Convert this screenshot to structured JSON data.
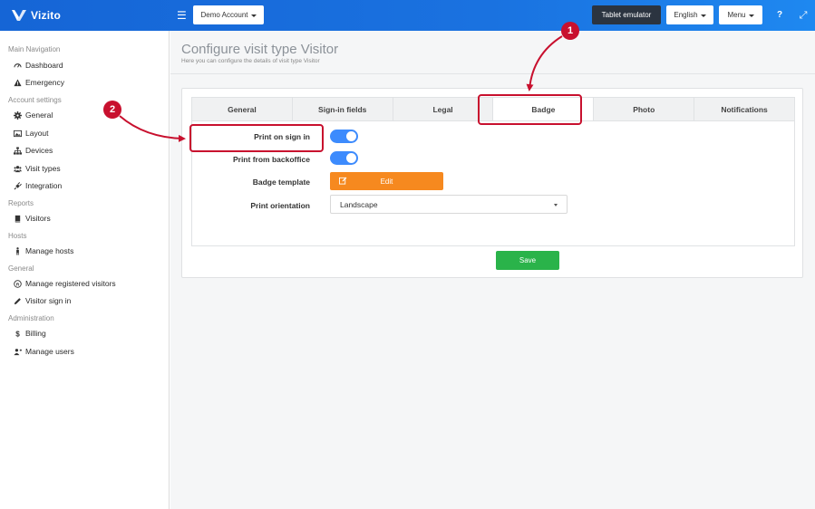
{
  "app": {
    "logo_text": "Vizito"
  },
  "topbar": {
    "account_label": "Demo Account",
    "tablet_label": "Tablet emulator",
    "language_label": "English",
    "menu_label": "Menu",
    "help_glyph": "?",
    "expand_glyph": "⤢"
  },
  "sidebar": {
    "sections": [
      {
        "heading": "Main Navigation",
        "items": [
          {
            "label": "Dashboard",
            "icon": "gauge-icon"
          },
          {
            "label": "Emergency",
            "icon": "warning-icon"
          }
        ]
      },
      {
        "heading": "Account settings",
        "items": [
          {
            "label": "General",
            "icon": "gear-icon"
          },
          {
            "label": "Layout",
            "icon": "image-icon"
          },
          {
            "label": "Devices",
            "icon": "sitemap-icon"
          },
          {
            "label": "Visit types",
            "icon": "users-icon"
          },
          {
            "label": "Integration",
            "icon": "plug-icon"
          }
        ]
      },
      {
        "heading": "Reports",
        "items": [
          {
            "label": "Visitors",
            "icon": "book-icon"
          }
        ]
      },
      {
        "heading": "Hosts",
        "items": [
          {
            "label": "Manage hosts",
            "icon": "male-icon"
          }
        ]
      },
      {
        "heading": "General",
        "items": [
          {
            "label": "Manage registered visitors",
            "icon": "registered-icon"
          },
          {
            "label": "Visitor sign in",
            "icon": "pencil-icon"
          }
        ]
      },
      {
        "heading": "Administration",
        "items": [
          {
            "label": "Billing",
            "icon": "dollar-icon"
          },
          {
            "label": "Manage users",
            "icon": "user-plus-icon"
          }
        ]
      }
    ]
  },
  "main": {
    "title": "Configure visit type Visitor",
    "subtitle": "Here you can configure the details of visit type Visitor",
    "tabs": [
      {
        "label": "General",
        "active": false
      },
      {
        "label": "Sign-in fields",
        "active": false
      },
      {
        "label": "Legal",
        "active": false
      },
      {
        "label": "Badge",
        "active": true
      },
      {
        "label": "Photo",
        "active": false
      },
      {
        "label": "Notifications",
        "active": false
      }
    ],
    "form": {
      "print_on_sign_in_label": "Print on sign in",
      "print_on_sign_in": true,
      "print_from_backoffice_label": "Print from backoffice",
      "print_from_backoffice": true,
      "badge_template_label": "Badge template",
      "edit_label": "Edit",
      "print_orientation_label": "Print orientation",
      "print_orientation_value": "Landscape"
    },
    "save_label": "Save"
  },
  "annotations": [
    {
      "number": "1",
      "target": "Badge tab"
    },
    {
      "number": "2",
      "target": "Print on sign in"
    }
  ],
  "colors": {
    "topbar": "#1a72e0",
    "toggle_on": "#3d8bfd",
    "edit_button": "#f6891f",
    "save_button": "#2ab34a",
    "annotation": "#c8102e"
  }
}
